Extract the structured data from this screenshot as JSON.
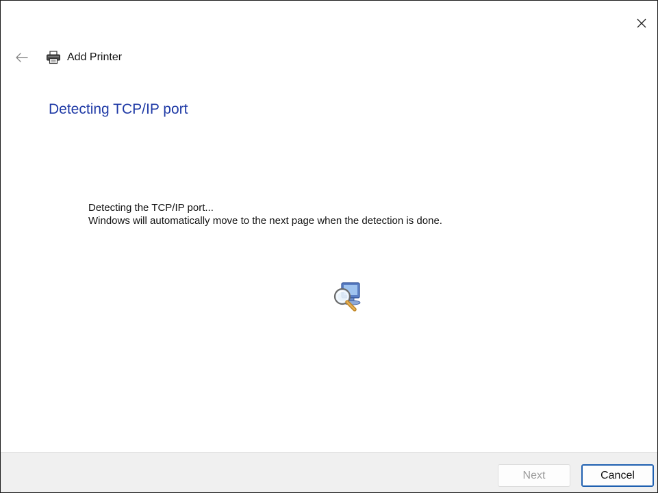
{
  "window": {
    "title": "Add Printer",
    "close_label": "Close",
    "back_label": "Back"
  },
  "page": {
    "heading": "Detecting TCP/IP port",
    "status_line1": "Detecting the TCP/IP port...",
    "status_line2": "Windows will automatically move to the next page when the detection is done."
  },
  "icons": {
    "back": "arrow-left-icon",
    "printer": "printer-icon",
    "detecting": "search-computer-icon",
    "close": "close-icon"
  },
  "footer": {
    "next_label": "Next",
    "cancel_label": "Cancel"
  },
  "colors": {
    "heading": "#1f3aa6",
    "accent": "#1e5fb0",
    "footer_bg": "#f0f0f0",
    "disabled_text": "#9c9c9c"
  }
}
